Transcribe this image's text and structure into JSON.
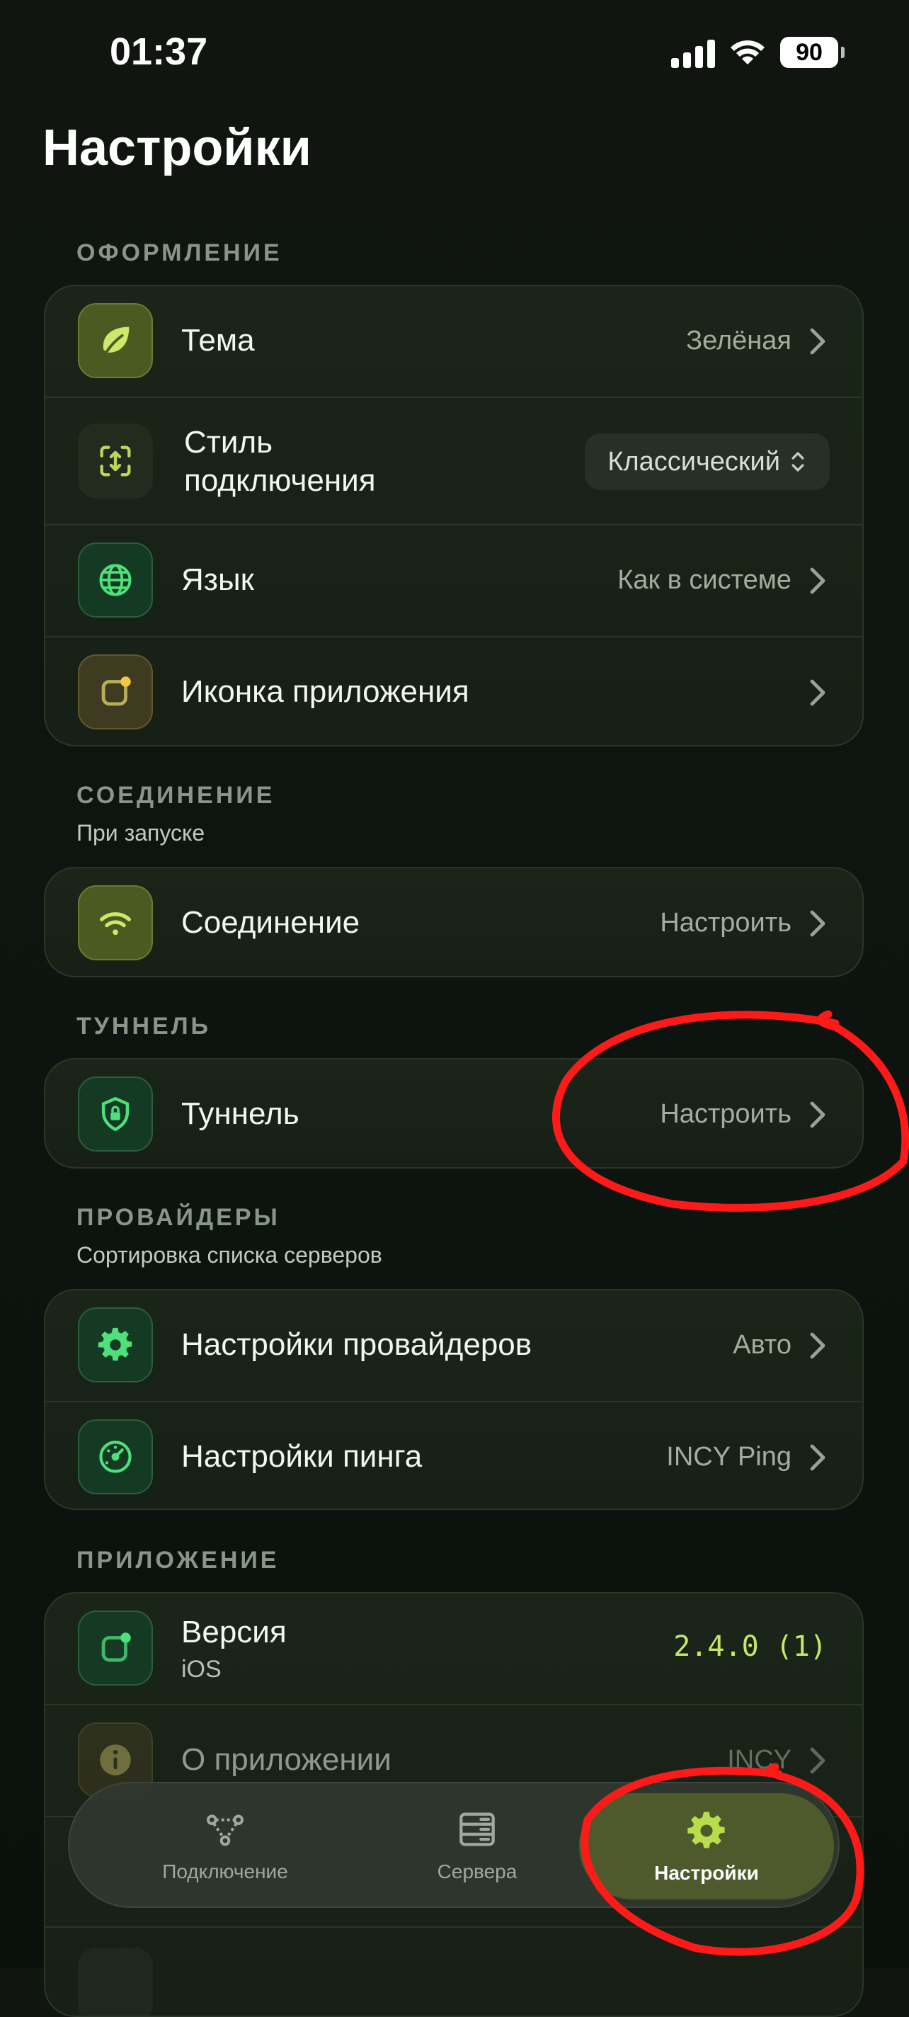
{
  "status_bar": {
    "time": "01:37",
    "battery": "90"
  },
  "page": {
    "title": "Настройки"
  },
  "sections": {
    "appearance": {
      "header": "ОФОРМЛЕНИЕ",
      "rows": {
        "theme": {
          "label": "Тема",
          "value": "Зелёная",
          "icon": "leaf-icon"
        },
        "style": {
          "label_line1": "Стиль",
          "label_line2": "подключения",
          "value": "Классический",
          "icon": "expand-arrows-icon"
        },
        "language": {
          "label": "Язык",
          "value": "Как в системе",
          "icon": "globe-icon"
        },
        "app_icon": {
          "label": "Иконка приложения",
          "icon": "app-icon-icon"
        }
      }
    },
    "connection": {
      "header": "СОЕДИНЕНИЕ",
      "subtitle": "При запуске",
      "rows": {
        "connection": {
          "label": "Соединение",
          "value": "Настроить",
          "icon": "wifi-icon"
        }
      }
    },
    "tunnel": {
      "header": "ТУННЕЛЬ",
      "rows": {
        "tunnel": {
          "label": "Туннель",
          "value": "Настроить",
          "icon": "shield-lock-icon"
        }
      }
    },
    "providers": {
      "header": "ПРОВАЙДЕРЫ",
      "subtitle": "Сортировка списка серверов",
      "rows": {
        "providers": {
          "label": "Настройки провайдеров",
          "value": "Авто",
          "icon": "gear-icon"
        },
        "ping": {
          "label": "Настройки пинга",
          "value": "INCY Ping",
          "icon": "speedometer-icon"
        }
      }
    },
    "application": {
      "header": "ПРИЛОЖЕНИЕ",
      "rows": {
        "version": {
          "label": "Версия",
          "sublabel": "iOS",
          "value": "2.4.0 (1)",
          "icon": "app-icon-icon"
        },
        "about": {
          "label": "О приложении",
          "value": "INCY",
          "icon": "info-icon"
        }
      }
    }
  },
  "tabbar": {
    "tabs": [
      {
        "label": "Подключение",
        "icon": "network-nodes-icon"
      },
      {
        "label": "Сервера",
        "icon": "server-icon"
      },
      {
        "label": "Настройки",
        "icon": "gear-icon",
        "active": true
      }
    ]
  },
  "colors": {
    "accent": "#a6cc3a",
    "annotation": "#ff0000",
    "background": "#0e1510"
  }
}
